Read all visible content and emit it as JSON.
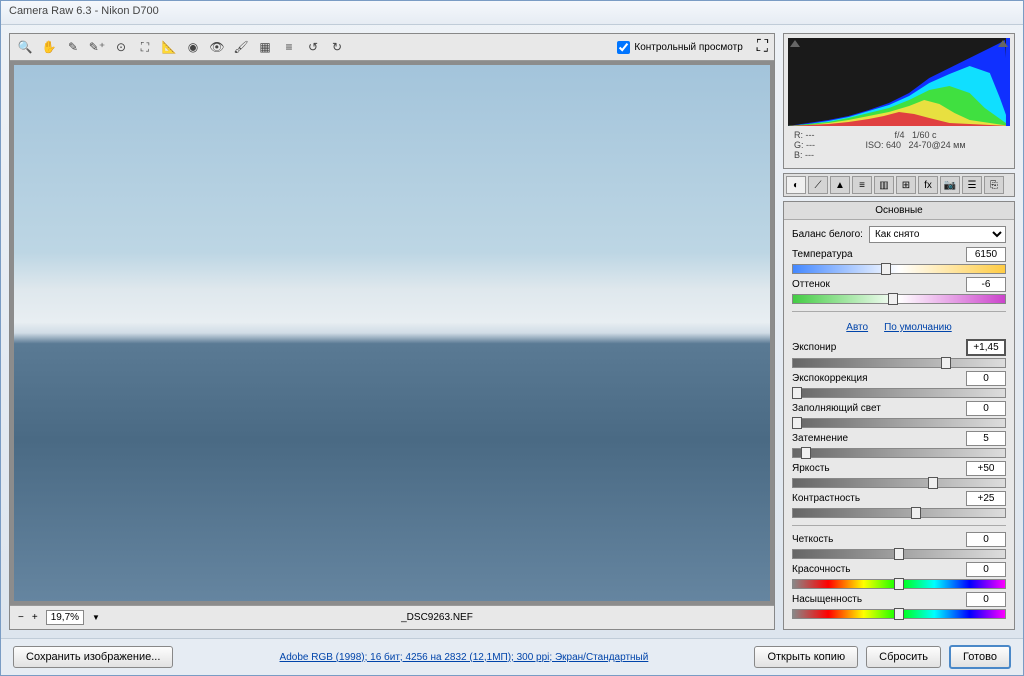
{
  "window": {
    "title": "Camera Raw 6.3  -  Nikon D700"
  },
  "preview_checkbox_label": "Контрольный просмотр",
  "zoom": "19,7%",
  "filename": "_DSC9263.NEF",
  "exif": {
    "r": "R:  ---",
    "g": "G:  ---",
    "b": "B:  ---",
    "aperture": "f/4",
    "shutter": "1/60 с",
    "iso": "ISO: 640",
    "lens": "24-70@24 мм"
  },
  "panel": {
    "title": "Основные",
    "wb_label": "Баланс белого:",
    "wb_value": "Как снято",
    "auto": "Авто",
    "default": "По умолчанию",
    "sliders": {
      "temperature": {
        "label": "Температура",
        "value": "6150",
        "pos": 44
      },
      "tint": {
        "label": "Оттенок",
        "value": "-6",
        "pos": 47
      },
      "exposure": {
        "label": "Экспонир",
        "value": "+1,45",
        "pos": 72
      },
      "recovery": {
        "label": "Экспокоррекция",
        "value": "0",
        "pos": 2
      },
      "fill": {
        "label": "Заполняющий свет",
        "value": "0",
        "pos": 2
      },
      "blacks": {
        "label": "Затемнение",
        "value": "5",
        "pos": 6
      },
      "brightness": {
        "label": "Яркость",
        "value": "+50",
        "pos": 66
      },
      "contrast": {
        "label": "Контрастность",
        "value": "+25",
        "pos": 58
      },
      "clarity": {
        "label": "Четкость",
        "value": "0",
        "pos": 50
      },
      "vibrance": {
        "label": "Красочность",
        "value": "0",
        "pos": 50
      },
      "saturation": {
        "label": "Насыщенность",
        "value": "0",
        "pos": 50
      }
    }
  },
  "footer": {
    "save": "Сохранить изображение...",
    "link": "Adobe RGB (1998); 16 бит; 4256 на 2832 (12,1МП); 300 ppi; Экран/Стандартный",
    "open": "Открыть копию",
    "reset": "Сбросить",
    "done": "Готово"
  }
}
